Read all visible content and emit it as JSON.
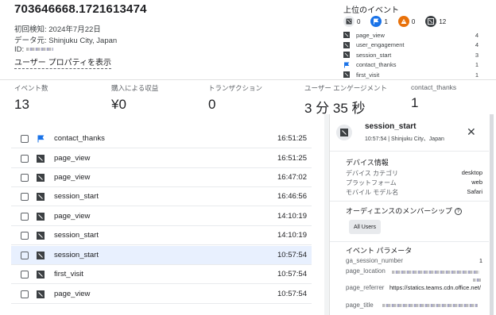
{
  "header": {
    "user_id": "703646668.1721613474",
    "first_seen": "初回検知: 2024年7月22日",
    "data_source": "データ元: Shinjuku City, Japan",
    "id_label": "ID:",
    "profile_link": "ユーザー プロパティを表示"
  },
  "top_events": {
    "title": "上位のイベント",
    "badges": [
      {
        "icon": "page-icon",
        "count": "0",
        "color": "#e8eaed"
      },
      {
        "icon": "flag-icon",
        "count": "1",
        "color": "#1a73e8"
      },
      {
        "icon": "warning-icon",
        "count": "0",
        "color": "#e8710a"
      },
      {
        "icon": "page-icon",
        "count": "12",
        "color": "#3c4043"
      }
    ],
    "items": [
      {
        "name": "page_view",
        "count": "4",
        "icon": "page-icon"
      },
      {
        "name": "user_engagement",
        "count": "4",
        "icon": "page-icon"
      },
      {
        "name": "session_start",
        "count": "3",
        "icon": "page-icon"
      },
      {
        "name": "contact_thanks",
        "count": "1",
        "icon": "flag-icon"
      },
      {
        "name": "first_visit",
        "count": "1",
        "icon": "page-icon"
      }
    ]
  },
  "summary": {
    "events_label": "イベント数",
    "events_value": "13",
    "revenue_label": "購入による収益",
    "revenue_value": "¥0",
    "transactions_label": "トランザクション",
    "transactions_value": "0",
    "engagement_label": "ユーザー エンゲージメント",
    "engagement_value": "3 分 35 秒",
    "contact_label": "contact_thanks",
    "contact_value": "1"
  },
  "events": [
    {
      "name": "contact_thanks",
      "time": "16:51:25",
      "icon": "flag-icon",
      "selected": false
    },
    {
      "name": "page_view",
      "time": "16:51:25",
      "icon": "page-icon",
      "selected": false
    },
    {
      "name": "page_view",
      "time": "16:47:02",
      "icon": "page-icon",
      "selected": false
    },
    {
      "name": "session_start",
      "time": "16:46:56",
      "icon": "page-icon",
      "selected": false
    },
    {
      "name": "page_view",
      "time": "14:10:19",
      "icon": "page-icon",
      "selected": false
    },
    {
      "name": "session_start",
      "time": "14:10:19",
      "icon": "page-icon",
      "selected": false
    },
    {
      "name": "session_start",
      "time": "10:57:54",
      "icon": "page-icon",
      "selected": true
    },
    {
      "name": "first_visit",
      "time": "10:57:54",
      "icon": "page-icon",
      "selected": false
    },
    {
      "name": "page_view",
      "time": "10:57:54",
      "icon": "page-icon",
      "selected": false
    }
  ],
  "detail": {
    "title": "session_start",
    "subtitle": "10:57:54 | Shinjuku City、Japan",
    "device_section": "デバイス情報",
    "device_category_label": "デバイス カテゴリ",
    "device_category_value": "desktop",
    "platform_label": "プラットフォーム",
    "platform_value": "web",
    "mobile_model_label": "モバイル モデル名",
    "mobile_model_value": "Safari",
    "audience_section": "オーディエンスのメンバーシップ",
    "audience_chip": "All Users",
    "params_section": "イベント パラメータ",
    "ga_session_number_label": "ga_session_number",
    "ga_session_number_value": "1",
    "page_location_label": "page_location",
    "page_referrer_label": "page_referrer",
    "page_referrer_value": "https://statics.teams.cdn.office.net/",
    "page_title_label": "page_title"
  },
  "colors": {
    "selected_row": "#e8f0fe",
    "flag_blue": "#1a73e8",
    "warning_orange": "#e8710a"
  }
}
